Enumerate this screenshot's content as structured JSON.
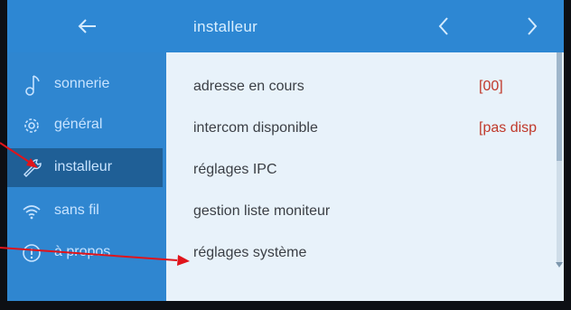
{
  "header": {
    "title": "installeur",
    "back_icon": "arrow-left-icon",
    "prev_icon": "chevron-left-icon",
    "next_icon": "chevron-right-icon"
  },
  "sidebar": {
    "items": [
      {
        "label": "sonnerie",
        "icon": "music-note-icon",
        "active": false
      },
      {
        "label": "général",
        "icon": "gear-icon",
        "active": false
      },
      {
        "label": "installeur",
        "icon": "wrench-icon",
        "active": true
      },
      {
        "label": "sans fil",
        "icon": "wifi-icon",
        "active": false
      },
      {
        "label": "à propos",
        "icon": "info-icon",
        "active": false
      }
    ]
  },
  "content": {
    "rows": [
      {
        "label": "adresse en cours",
        "value": "[00]"
      },
      {
        "label": "intercom disponible",
        "value": "[pas disp"
      },
      {
        "label": "réglages IPC",
        "value": ""
      },
      {
        "label": "gestion liste moniteur",
        "value": ""
      },
      {
        "label": "réglages système",
        "value": ""
      }
    ]
  },
  "colors": {
    "screen_blue": "#2f86d0",
    "active_item": "#1f5f96",
    "content_bg": "#e8f2fa",
    "value_red": "#c0392b",
    "annotation_arrow": "#e0141b"
  },
  "annotations": [
    "red-arrow-to-installeur",
    "red-arrow-to-reglages-systeme"
  ]
}
